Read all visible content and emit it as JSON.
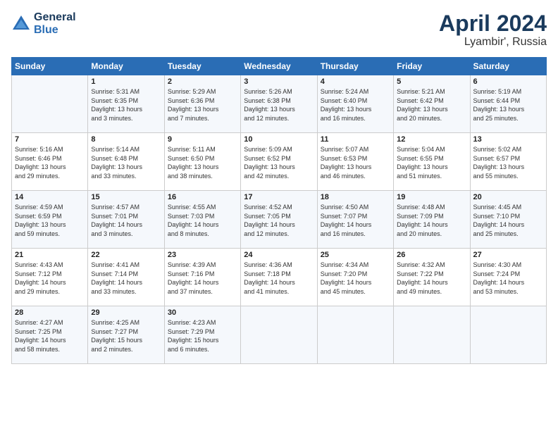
{
  "header": {
    "logo_line1": "General",
    "logo_line2": "Blue",
    "month": "April 2024",
    "location": "Lyambir', Russia"
  },
  "days_of_week": [
    "Sunday",
    "Monday",
    "Tuesday",
    "Wednesday",
    "Thursday",
    "Friday",
    "Saturday"
  ],
  "weeks": [
    [
      {
        "day": "",
        "info": ""
      },
      {
        "day": "1",
        "info": "Sunrise: 5:31 AM\nSunset: 6:35 PM\nDaylight: 13 hours\nand 3 minutes."
      },
      {
        "day": "2",
        "info": "Sunrise: 5:29 AM\nSunset: 6:36 PM\nDaylight: 13 hours\nand 7 minutes."
      },
      {
        "day": "3",
        "info": "Sunrise: 5:26 AM\nSunset: 6:38 PM\nDaylight: 13 hours\nand 12 minutes."
      },
      {
        "day": "4",
        "info": "Sunrise: 5:24 AM\nSunset: 6:40 PM\nDaylight: 13 hours\nand 16 minutes."
      },
      {
        "day": "5",
        "info": "Sunrise: 5:21 AM\nSunset: 6:42 PM\nDaylight: 13 hours\nand 20 minutes."
      },
      {
        "day": "6",
        "info": "Sunrise: 5:19 AM\nSunset: 6:44 PM\nDaylight: 13 hours\nand 25 minutes."
      }
    ],
    [
      {
        "day": "7",
        "info": "Sunrise: 5:16 AM\nSunset: 6:46 PM\nDaylight: 13 hours\nand 29 minutes."
      },
      {
        "day": "8",
        "info": "Sunrise: 5:14 AM\nSunset: 6:48 PM\nDaylight: 13 hours\nand 33 minutes."
      },
      {
        "day": "9",
        "info": "Sunrise: 5:11 AM\nSunset: 6:50 PM\nDaylight: 13 hours\nand 38 minutes."
      },
      {
        "day": "10",
        "info": "Sunrise: 5:09 AM\nSunset: 6:52 PM\nDaylight: 13 hours\nand 42 minutes."
      },
      {
        "day": "11",
        "info": "Sunrise: 5:07 AM\nSunset: 6:53 PM\nDaylight: 13 hours\nand 46 minutes."
      },
      {
        "day": "12",
        "info": "Sunrise: 5:04 AM\nSunset: 6:55 PM\nDaylight: 13 hours\nand 51 minutes."
      },
      {
        "day": "13",
        "info": "Sunrise: 5:02 AM\nSunset: 6:57 PM\nDaylight: 13 hours\nand 55 minutes."
      }
    ],
    [
      {
        "day": "14",
        "info": "Sunrise: 4:59 AM\nSunset: 6:59 PM\nDaylight: 13 hours\nand 59 minutes."
      },
      {
        "day": "15",
        "info": "Sunrise: 4:57 AM\nSunset: 7:01 PM\nDaylight: 14 hours\nand 3 minutes."
      },
      {
        "day": "16",
        "info": "Sunrise: 4:55 AM\nSunset: 7:03 PM\nDaylight: 14 hours\nand 8 minutes."
      },
      {
        "day": "17",
        "info": "Sunrise: 4:52 AM\nSunset: 7:05 PM\nDaylight: 14 hours\nand 12 minutes."
      },
      {
        "day": "18",
        "info": "Sunrise: 4:50 AM\nSunset: 7:07 PM\nDaylight: 14 hours\nand 16 minutes."
      },
      {
        "day": "19",
        "info": "Sunrise: 4:48 AM\nSunset: 7:09 PM\nDaylight: 14 hours\nand 20 minutes."
      },
      {
        "day": "20",
        "info": "Sunrise: 4:45 AM\nSunset: 7:10 PM\nDaylight: 14 hours\nand 25 minutes."
      }
    ],
    [
      {
        "day": "21",
        "info": "Sunrise: 4:43 AM\nSunset: 7:12 PM\nDaylight: 14 hours\nand 29 minutes."
      },
      {
        "day": "22",
        "info": "Sunrise: 4:41 AM\nSunset: 7:14 PM\nDaylight: 14 hours\nand 33 minutes."
      },
      {
        "day": "23",
        "info": "Sunrise: 4:39 AM\nSunset: 7:16 PM\nDaylight: 14 hours\nand 37 minutes."
      },
      {
        "day": "24",
        "info": "Sunrise: 4:36 AM\nSunset: 7:18 PM\nDaylight: 14 hours\nand 41 minutes."
      },
      {
        "day": "25",
        "info": "Sunrise: 4:34 AM\nSunset: 7:20 PM\nDaylight: 14 hours\nand 45 minutes."
      },
      {
        "day": "26",
        "info": "Sunrise: 4:32 AM\nSunset: 7:22 PM\nDaylight: 14 hours\nand 49 minutes."
      },
      {
        "day": "27",
        "info": "Sunrise: 4:30 AM\nSunset: 7:24 PM\nDaylight: 14 hours\nand 53 minutes."
      }
    ],
    [
      {
        "day": "28",
        "info": "Sunrise: 4:27 AM\nSunset: 7:25 PM\nDaylight: 14 hours\nand 58 minutes."
      },
      {
        "day": "29",
        "info": "Sunrise: 4:25 AM\nSunset: 7:27 PM\nDaylight: 15 hours\nand 2 minutes."
      },
      {
        "day": "30",
        "info": "Sunrise: 4:23 AM\nSunset: 7:29 PM\nDaylight: 15 hours\nand 6 minutes."
      },
      {
        "day": "",
        "info": ""
      },
      {
        "day": "",
        "info": ""
      },
      {
        "day": "",
        "info": ""
      },
      {
        "day": "",
        "info": ""
      }
    ]
  ]
}
